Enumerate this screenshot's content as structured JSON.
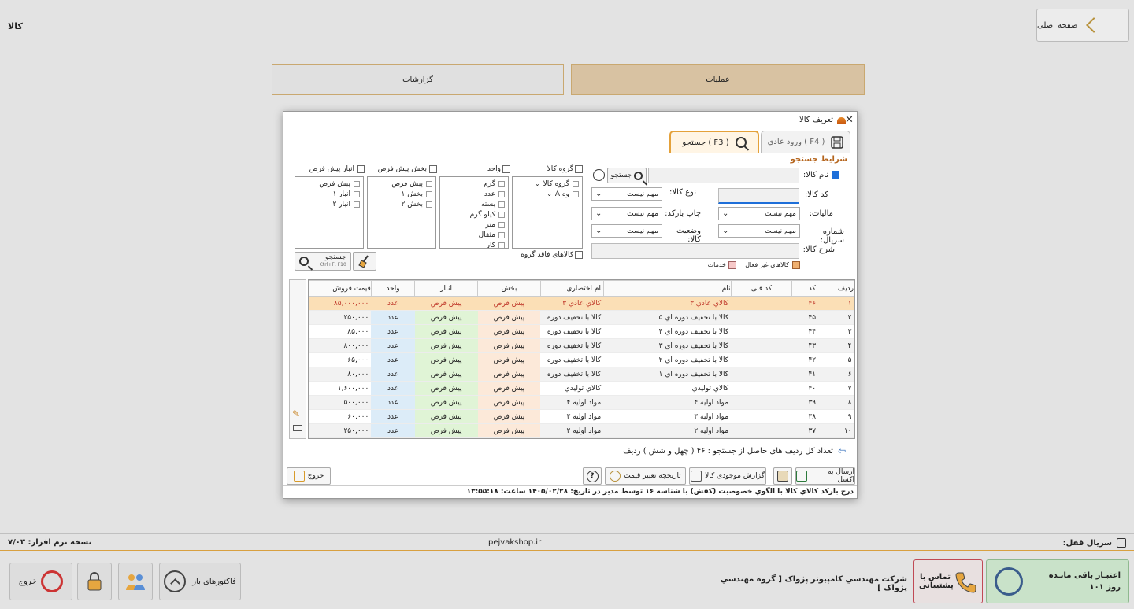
{
  "app": {
    "title": "کالا",
    "home_label": "صفحه اصلی"
  },
  "main_tabs": {
    "operations": "عملیات",
    "reports": "گزارشات"
  },
  "status": {
    "version_label": "نسخه نرم افزار: ۷/۰۳",
    "site": "pejvakshop.ir",
    "serial_label": "سریال قفل:"
  },
  "bottom": {
    "exit": "خروج",
    "open_invoices": "فاکتورهای باز",
    "company": "شرکت مهندسي کامپيوتر پژواک [ گروه مهندسي پژواک ]",
    "support": "تماس با پشتیبانی",
    "credit_line1": "اعتبـار باقی مانـده",
    "credit_line2": "۱۰۱ روز"
  },
  "dialog": {
    "title": "تعریف کالا",
    "close": "✕",
    "tab_normal": "ورود عادی ( F4 )",
    "tab_search": "جستجو ( F3 )",
    "conditions_title": "شرایط جستجو",
    "fields": {
      "name_label": "نام کالا:",
      "name_checked": true,
      "search_btn": "جستجو",
      "info_icon": "i",
      "code_label": "کد کالا:",
      "type_label": "نوع کالا:",
      "type_value": "مهم نیست",
      "tax_label": "مالیات:",
      "tax_value": "مهم نیست",
      "barcode_label": "چاپ بارکد:",
      "barcode_value": "مهم نیست",
      "serial_label": "شماره سریال:",
      "serial_value": "مهم نیست",
      "status_label": "وضعیت کالا:",
      "status_value": "مهم نیست",
      "desc_label": "شرح کالا:",
      "legend_inactive": "کالاهای غیر فعال",
      "legend_services": "خدمات"
    },
    "filters": {
      "group_label": "گروه کالا",
      "group_tree": [
        "گروه کالا",
        "وه A"
      ],
      "no_group": "کالاهای فاقد گروه",
      "unit_label": "واحد",
      "units": [
        "گرم",
        "عدد",
        "بسته",
        "کیلو گرم",
        "متر",
        "مثقال",
        "کار"
      ],
      "section_label": "بخش پیش فرض",
      "sections": [
        "پیش فرض",
        "بخش ۱",
        "بخش ۲"
      ],
      "warehouse_label": "انبار پیش فرض",
      "warehouses": [
        "پیش فرض",
        "انبار ۱",
        "انبار ۲"
      ],
      "search_btn": "جستجو",
      "search_shortcut": "Ctrl+F, F10"
    },
    "grid": {
      "headers": [
        "ردیف",
        "کد",
        "کد فنی",
        "نام",
        "نام اختصاری",
        "بخش",
        "انبار",
        "واحد",
        "قیمت فروش"
      ],
      "rows": [
        [
          "۱",
          "۴۶",
          "",
          "کالاي عادي ۳",
          "کالاي عادي ۳",
          "پیش فرض",
          "پیش فرض",
          "عدد",
          "۸۵,۰۰۰,۰۰۰"
        ],
        [
          "۲",
          "۴۵",
          "",
          "کالا با تخفیف دوره اي ۵",
          "کالا با تخفیف دوره",
          "پیش فرض",
          "پیش فرض",
          "عدد",
          "۲۵۰,۰۰۰"
        ],
        [
          "۳",
          "۴۴",
          "",
          "کالا با تخفیف دوره اي ۴",
          "کالا با تخفیف دوره",
          "پیش فرض",
          "پیش فرض",
          "عدد",
          "۸۵,۰۰۰"
        ],
        [
          "۴",
          "۴۳",
          "",
          "کالا با تخفیف دوره اي ۳",
          "کالا با تخفیف دوره",
          "پیش فرض",
          "پیش فرض",
          "عدد",
          "۸۰۰,۰۰۰"
        ],
        [
          "۵",
          "۴۲",
          "",
          "کالا با تخفیف دوره اي ۲",
          "کالا با تخفیف دوره",
          "پیش فرض",
          "پیش فرض",
          "عدد",
          "۶۵,۰۰۰"
        ],
        [
          "۶",
          "۴۱",
          "",
          "کالا با تخفیف دوره اي ۱",
          "کالا با تخفیف دوره",
          "پیش فرض",
          "پیش فرض",
          "عدد",
          "۸۰,۰۰۰"
        ],
        [
          "۷",
          "۴۰",
          "",
          "کالاي توليدي",
          "کالاي توليدي",
          "پیش فرض",
          "پیش فرض",
          "عدد",
          "۱,۶۰۰,۰۰۰"
        ],
        [
          "۸",
          "۳۹",
          "",
          "مواد اولیه ۴",
          "مواد اولیه ۴",
          "پیش فرض",
          "پیش فرض",
          "عدد",
          "۵۰۰,۰۰۰"
        ],
        [
          "۹",
          "۳۸",
          "",
          "مواد اولیه ۳",
          "مواد اولیه ۳",
          "پیش فرض",
          "پیش فرض",
          "عدد",
          "۶۰,۰۰۰"
        ],
        [
          "۱۰",
          "۳۷",
          "",
          "مواد اولیه ۲",
          "مواد اولیه ۲",
          "پیش فرض",
          "پیش فرض",
          "عدد",
          "۲۵۰,۰۰۰"
        ]
      ]
    },
    "count_text": "تعداد کل ردیف های حاصل از جستجو : ۴۶ ( چهل و شش ) ردیف",
    "buttons": {
      "excel": "ارسال به اکسل",
      "stock_report": "گزارش موجودی کالا",
      "price_history": "تاریخچه تغییر قیمت",
      "exit": "خروج"
    },
    "footnote": "درج بارکد کالاي کالا با الگوي خصوصيت (کفش) با شناسه ۱۶ توسط مدير در تاريخ: ۱۴۰۵/۰۲/۲۸ ساعت: ۱۳:۵۵:۱۸"
  }
}
